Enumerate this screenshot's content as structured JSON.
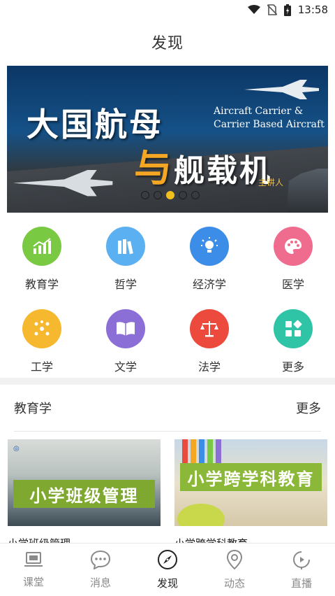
{
  "status_bar": {
    "time": "13:58"
  },
  "header": {
    "title": "发现"
  },
  "banner": {
    "title_line1": "大国航母",
    "title_line2_accent": "与",
    "title_line2_rest": "舰载机",
    "subtitle_en": "Aircraft Carrier &\nCarrier Based Aircraft",
    "speaker": "主讲人",
    "slide_count": 5,
    "active_slide": 3
  },
  "categories": [
    {
      "label": "教育学",
      "icon": "bar-chart-icon",
      "color": "#7ac943"
    },
    {
      "label": "哲学",
      "icon": "books-icon",
      "color": "#5ab0f0"
    },
    {
      "label": "经济学",
      "icon": "lightbulb-icon",
      "color": "#3c8de8"
    },
    {
      "label": "医学",
      "icon": "palette-icon",
      "color": "#f06c8f"
    },
    {
      "label": "工学",
      "icon": "molecule-icon",
      "color": "#f5b82e"
    },
    {
      "label": "文学",
      "icon": "open-book-icon",
      "color": "#8b6fd6"
    },
    {
      "label": "法学",
      "icon": "scales-icon",
      "color": "#ec4a3c"
    },
    {
      "label": "更多",
      "icon": "grid-more-icon",
      "color": "#2fc4a6"
    }
  ],
  "section": {
    "title": "教育学",
    "more_label": "更多"
  },
  "courses": [
    {
      "thumb_text": "小学班级管理",
      "title": "小学班级管理",
      "banner_color": "#7ea82f"
    },
    {
      "thumb_text": "小学跨学科教育",
      "title": "小学跨学科教育",
      "banner_color": "#8cb83a"
    }
  ],
  "tabs": [
    {
      "label": "课堂",
      "icon": "laptop-icon",
      "active": false
    },
    {
      "label": "消息",
      "icon": "chat-bubble-icon",
      "active": false
    },
    {
      "label": "发现",
      "icon": "compass-icon",
      "active": true
    },
    {
      "label": "动态",
      "icon": "location-pin-icon",
      "active": false
    },
    {
      "label": "直播",
      "icon": "live-play-icon",
      "active": false
    }
  ],
  "colors": {
    "accent": "#f2c01e",
    "text": "#333333",
    "inactive": "#8a8a8a"
  }
}
